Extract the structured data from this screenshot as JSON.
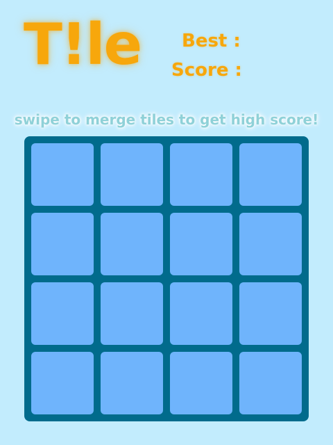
{
  "game": {
    "title": "T!le",
    "best_label": "Best :",
    "best_value": "",
    "score_label": "Score :",
    "score_value": "",
    "hint": "swipe to merge tiles to get high score!"
  },
  "board": {
    "rows": 4,
    "cols": 4,
    "cells": [
      [
        "",
        "",
        "",
        ""
      ],
      [
        "",
        "",
        "",
        ""
      ],
      [
        "",
        "",
        "",
        ""
      ],
      [
        "",
        "",
        "",
        ""
      ]
    ]
  },
  "colors": {
    "background": "#c2ecfd",
    "accent": "#f7a70c",
    "board": "#016b8c",
    "cell_empty": "#6fb4fc",
    "hint_text": "#8fd1d8"
  }
}
